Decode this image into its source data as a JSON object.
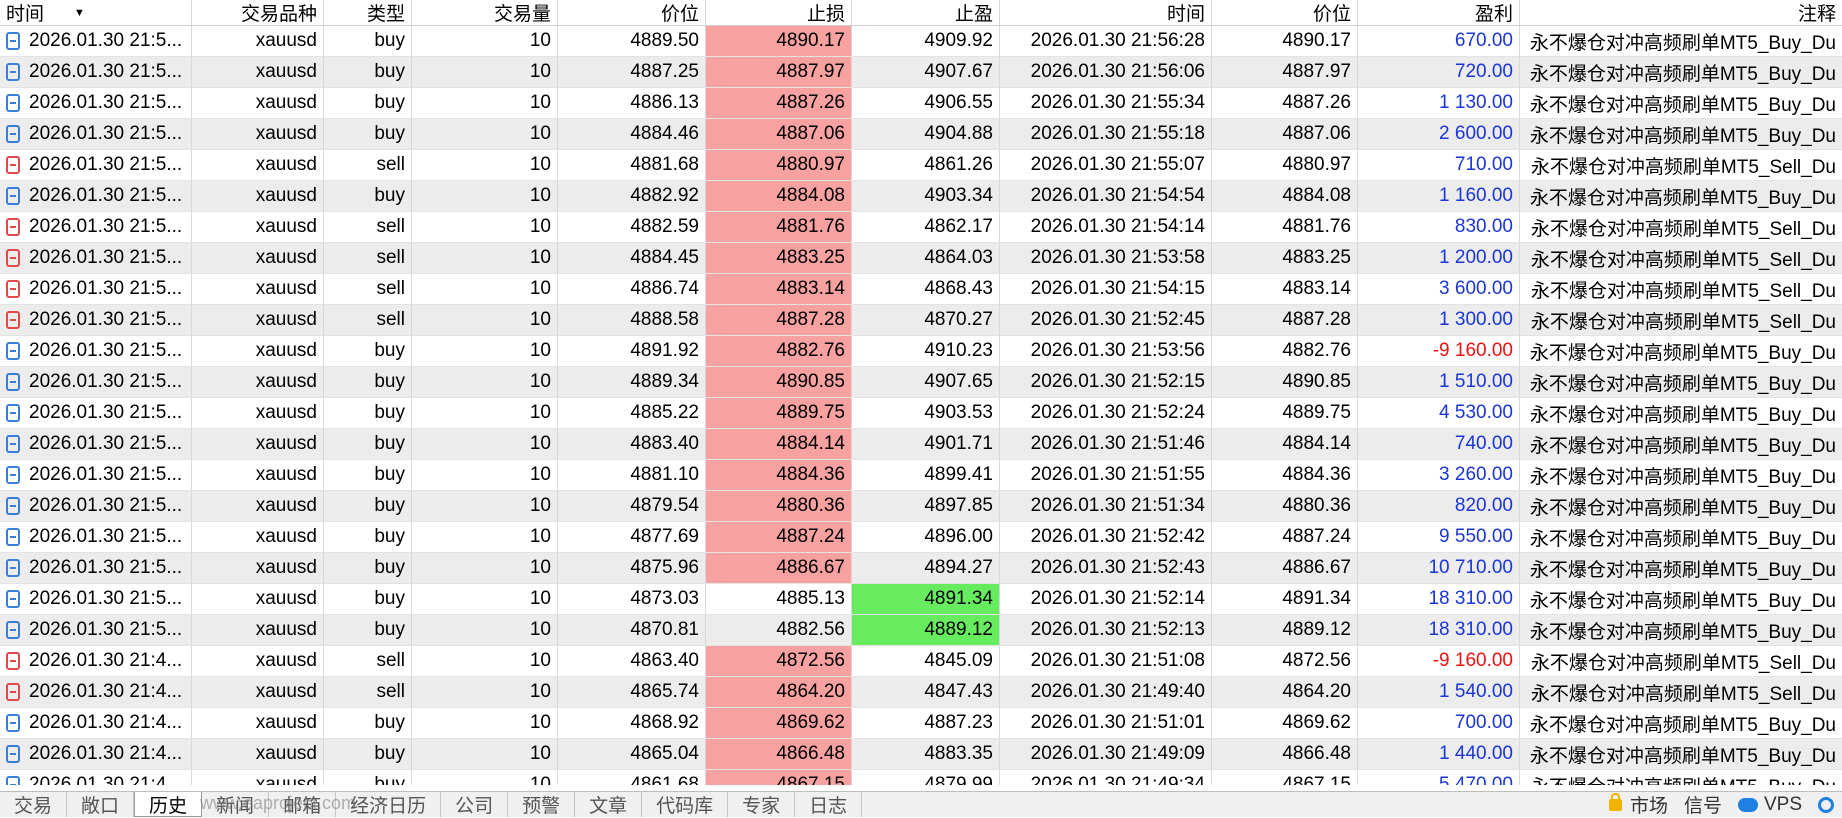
{
  "columns": [
    "时间",
    "交易品种",
    "类型",
    "交易量",
    "价位",
    "止损",
    "止盈",
    "时间",
    "价位",
    "盈利",
    "注释"
  ],
  "rows": [
    {
      "open_time": "2026.01.30 21:5...",
      "symbol": "xauusd",
      "type": "buy",
      "volume": "10",
      "price": "4889.50",
      "sl": "4890.17",
      "tp": "4909.92",
      "close_time": "2026.01.30 21:56:28",
      "close_price": "4890.17",
      "profit": "670.00",
      "comment": "永不爆仓对冲高频刷单MT5_Buy_Du",
      "hl": "sl"
    },
    {
      "open_time": "2026.01.30 21:5...",
      "symbol": "xauusd",
      "type": "buy",
      "volume": "10",
      "price": "4887.25",
      "sl": "4887.97",
      "tp": "4907.67",
      "close_time": "2026.01.30 21:56:06",
      "close_price": "4887.97",
      "profit": "720.00",
      "comment": "永不爆仓对冲高频刷单MT5_Buy_Du",
      "hl": "sl"
    },
    {
      "open_time": "2026.01.30 21:5...",
      "symbol": "xauusd",
      "type": "buy",
      "volume": "10",
      "price": "4886.13",
      "sl": "4887.26",
      "tp": "4906.55",
      "close_time": "2026.01.30 21:55:34",
      "close_price": "4887.26",
      "profit": "1 130.00",
      "comment": "永不爆仓对冲高频刷单MT5_Buy_Du",
      "hl": "sl"
    },
    {
      "open_time": "2026.01.30 21:5...",
      "symbol": "xauusd",
      "type": "buy",
      "volume": "10",
      "price": "4884.46",
      "sl": "4887.06",
      "tp": "4904.88",
      "close_time": "2026.01.30 21:55:18",
      "close_price": "4887.06",
      "profit": "2 600.00",
      "comment": "永不爆仓对冲高频刷单MT5_Buy_Du",
      "hl": "sl"
    },
    {
      "open_time": "2026.01.30 21:5...",
      "symbol": "xauusd",
      "type": "sell",
      "volume": "10",
      "price": "4881.68",
      "sl": "4880.97",
      "tp": "4861.26",
      "close_time": "2026.01.30 21:55:07",
      "close_price": "4880.97",
      "profit": "710.00",
      "comment": "永不爆仓对冲高频刷单MT5_Sell_Du",
      "hl": "sl"
    },
    {
      "open_time": "2026.01.30 21:5...",
      "symbol": "xauusd",
      "type": "buy",
      "volume": "10",
      "price": "4882.92",
      "sl": "4884.08",
      "tp": "4903.34",
      "close_time": "2026.01.30 21:54:54",
      "close_price": "4884.08",
      "profit": "1 160.00",
      "comment": "永不爆仓对冲高频刷单MT5_Buy_Du",
      "hl": "sl"
    },
    {
      "open_time": "2026.01.30 21:5...",
      "symbol": "xauusd",
      "type": "sell",
      "volume": "10",
      "price": "4882.59",
      "sl": "4881.76",
      "tp": "4862.17",
      "close_time": "2026.01.30 21:54:14",
      "close_price": "4881.76",
      "profit": "830.00",
      "comment": "永不爆仓对冲高频刷单MT5_Sell_Du",
      "hl": "sl"
    },
    {
      "open_time": "2026.01.30 21:5...",
      "symbol": "xauusd",
      "type": "sell",
      "volume": "10",
      "price": "4884.45",
      "sl": "4883.25",
      "tp": "4864.03",
      "close_time": "2026.01.30 21:53:58",
      "close_price": "4883.25",
      "profit": "1 200.00",
      "comment": "永不爆仓对冲高频刷单MT5_Sell_Du",
      "hl": "sl"
    },
    {
      "open_time": "2026.01.30 21:5...",
      "symbol": "xauusd",
      "type": "sell",
      "volume": "10",
      "price": "4886.74",
      "sl": "4883.14",
      "tp": "4868.43",
      "close_time": "2026.01.30 21:54:15",
      "close_price": "4883.14",
      "profit": "3 600.00",
      "comment": "永不爆仓对冲高频刷单MT5_Sell_Du",
      "hl": "sl"
    },
    {
      "open_time": "2026.01.30 21:5...",
      "symbol": "xauusd",
      "type": "sell",
      "volume": "10",
      "price": "4888.58",
      "sl": "4887.28",
      "tp": "4870.27",
      "close_time": "2026.01.30 21:52:45",
      "close_price": "4887.28",
      "profit": "1 300.00",
      "comment": "永不爆仓对冲高频刷单MT5_Sell_Du",
      "hl": "sl"
    },
    {
      "open_time": "2026.01.30 21:5...",
      "symbol": "xauusd",
      "type": "buy",
      "volume": "10",
      "price": "4891.92",
      "sl": "4882.76",
      "tp": "4910.23",
      "close_time": "2026.01.30 21:53:56",
      "close_price": "4882.76",
      "profit": "-9 160.00",
      "comment": "永不爆仓对冲高频刷单MT5_Buy_Du",
      "hl": "sl"
    },
    {
      "open_time": "2026.01.30 21:5...",
      "symbol": "xauusd",
      "type": "buy",
      "volume": "10",
      "price": "4889.34",
      "sl": "4890.85",
      "tp": "4907.65",
      "close_time": "2026.01.30 21:52:15",
      "close_price": "4890.85",
      "profit": "1 510.00",
      "comment": "永不爆仓对冲高频刷单MT5_Buy_Du",
      "hl": "sl"
    },
    {
      "open_time": "2026.01.30 21:5...",
      "symbol": "xauusd",
      "type": "buy",
      "volume": "10",
      "price": "4885.22",
      "sl": "4889.75",
      "tp": "4903.53",
      "close_time": "2026.01.30 21:52:24",
      "close_price": "4889.75",
      "profit": "4 530.00",
      "comment": "永不爆仓对冲高频刷单MT5_Buy_Du",
      "hl": "sl"
    },
    {
      "open_time": "2026.01.30 21:5...",
      "symbol": "xauusd",
      "type": "buy",
      "volume": "10",
      "price": "4883.40",
      "sl": "4884.14",
      "tp": "4901.71",
      "close_time": "2026.01.30 21:51:46",
      "close_price": "4884.14",
      "profit": "740.00",
      "comment": "永不爆仓对冲高频刷单MT5_Buy_Du",
      "hl": "sl"
    },
    {
      "open_time": "2026.01.30 21:5...",
      "symbol": "xauusd",
      "type": "buy",
      "volume": "10",
      "price": "4881.10",
      "sl": "4884.36",
      "tp": "4899.41",
      "close_time": "2026.01.30 21:51:55",
      "close_price": "4884.36",
      "profit": "3 260.00",
      "comment": "永不爆仓对冲高频刷单MT5_Buy_Du",
      "hl": "sl"
    },
    {
      "open_time": "2026.01.30 21:5...",
      "symbol": "xauusd",
      "type": "buy",
      "volume": "10",
      "price": "4879.54",
      "sl": "4880.36",
      "tp": "4897.85",
      "close_time": "2026.01.30 21:51:34",
      "close_price": "4880.36",
      "profit": "820.00",
      "comment": "永不爆仓对冲高频刷单MT5_Buy_Du",
      "hl": "sl"
    },
    {
      "open_time": "2026.01.30 21:5...",
      "symbol": "xauusd",
      "type": "buy",
      "volume": "10",
      "price": "4877.69",
      "sl": "4887.24",
      "tp": "4896.00",
      "close_time": "2026.01.30 21:52:42",
      "close_price": "4887.24",
      "profit": "9 550.00",
      "comment": "永不爆仓对冲高频刷单MT5_Buy_Du",
      "hl": "sl"
    },
    {
      "open_time": "2026.01.30 21:5...",
      "symbol": "xauusd",
      "type": "buy",
      "volume": "10",
      "price": "4875.96",
      "sl": "4886.67",
      "tp": "4894.27",
      "close_time": "2026.01.30 21:52:43",
      "close_price": "4886.67",
      "profit": "10 710.00",
      "comment": "永不爆仓对冲高频刷单MT5_Buy_Du",
      "hl": "sl"
    },
    {
      "open_time": "2026.01.30 21:5...",
      "symbol": "xauusd",
      "type": "buy",
      "volume": "10",
      "price": "4873.03",
      "sl": "4885.13",
      "tp": "4891.34",
      "close_time": "2026.01.30 21:52:14",
      "close_price": "4891.34",
      "profit": "18 310.00",
      "comment": "永不爆仓对冲高频刷单MT5_Buy_Du",
      "hl": "tp"
    },
    {
      "open_time": "2026.01.30 21:5...",
      "symbol": "xauusd",
      "type": "buy",
      "volume": "10",
      "price": "4870.81",
      "sl": "4882.56",
      "tp": "4889.12",
      "close_time": "2026.01.30 21:52:13",
      "close_price": "4889.12",
      "profit": "18 310.00",
      "comment": "永不爆仓对冲高频刷单MT5_Buy_Du",
      "hl": "tp"
    },
    {
      "open_time": "2026.01.30 21:4...",
      "symbol": "xauusd",
      "type": "sell",
      "volume": "10",
      "price": "4863.40",
      "sl": "4872.56",
      "tp": "4845.09",
      "close_time": "2026.01.30 21:51:08",
      "close_price": "4872.56",
      "profit": "-9 160.00",
      "comment": "永不爆仓对冲高频刷单MT5_Sell_Du",
      "hl": "sl"
    },
    {
      "open_time": "2026.01.30 21:4...",
      "symbol": "xauusd",
      "type": "sell",
      "volume": "10",
      "price": "4865.74",
      "sl": "4864.20",
      "tp": "4847.43",
      "close_time": "2026.01.30 21:49:40",
      "close_price": "4864.20",
      "profit": "1 540.00",
      "comment": "永不爆仓对冲高频刷单MT5_Sell_Du",
      "hl": "sl"
    },
    {
      "open_time": "2026.01.30 21:4...",
      "symbol": "xauusd",
      "type": "buy",
      "volume": "10",
      "price": "4868.92",
      "sl": "4869.62",
      "tp": "4887.23",
      "close_time": "2026.01.30 21:51:01",
      "close_price": "4869.62",
      "profit": "700.00",
      "comment": "永不爆仓对冲高频刷单MT5_Buy_Du",
      "hl": "sl"
    },
    {
      "open_time": "2026.01.30 21:4...",
      "symbol": "xauusd",
      "type": "buy",
      "volume": "10",
      "price": "4865.04",
      "sl": "4866.48",
      "tp": "4883.35",
      "close_time": "2026.01.30 21:49:09",
      "close_price": "4866.48",
      "profit": "1 440.00",
      "comment": "永不爆仓对冲高频刷单MT5_Buy_Du",
      "hl": "sl"
    },
    {
      "open_time": "2026.01.30 21:4...",
      "symbol": "xauusd",
      "type": "buy",
      "volume": "10",
      "price": "4861.68",
      "sl": "4867.15",
      "tp": "4879.99",
      "close_time": "2026.01.30 21:49:34",
      "close_price": "4867.15",
      "profit": "5 470.00",
      "comment": "永不爆仓对冲高频刷单MT5_Buy_Du",
      "hl": "sl"
    }
  ],
  "tabs": [
    "交易",
    "敞口",
    "历史",
    "新闻",
    "邮箱",
    "经济日历",
    "公司",
    "预警",
    "文章",
    "代码库",
    "专家",
    "日志"
  ],
  "active_tab": "历史",
  "status_right": {
    "market": "市场",
    "signals": "信号",
    "vps": "VPS"
  },
  "watermark": "www.eaproject.com",
  "colors": {
    "sl_highlight": "#f7a1a1",
    "tp_highlight": "#66ec5e",
    "profit_positive": "#1a35d8",
    "profit_negative": "#ee1111",
    "buy_icon": "#3a7ed8",
    "sell_icon": "#e24a4a"
  },
  "icons": {
    "buy": "buy-deal-icon",
    "sell": "sell-deal-icon",
    "sort": "sort-desc-icon",
    "market": "lock-icon",
    "vps": "cloud-icon",
    "settings": "gear-icon"
  }
}
